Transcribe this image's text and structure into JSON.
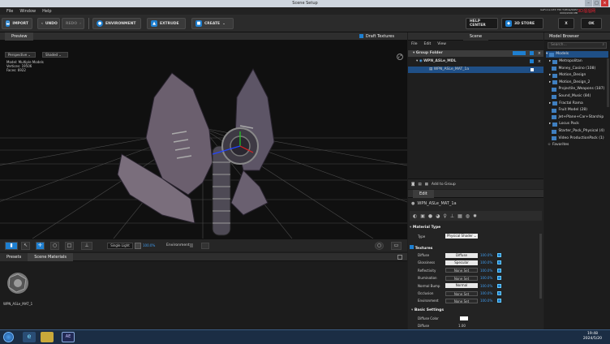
{
  "window": {
    "title": "Scene Setup",
    "controls": [
      "–",
      "□",
      "×"
    ]
  },
  "menu": [
    "File",
    "Window",
    "Help"
  ],
  "gpu_info": [
    "GeForce GTX 750 Ti/PCIe/SSE2",
    "0000/2000 MB",
    "8 / 4096"
  ],
  "watermark": "3D溜溜网",
  "toolbar": {
    "import": "IMPORT",
    "undo": "UNDO",
    "redo": "REDO",
    "environment": "ENVIRONMENT",
    "extrude": "EXTRUDE",
    "create": "CREATE",
    "help": "HELP CENTER",
    "store": "3D STORE",
    "close": "X",
    "ok": "OK"
  },
  "preview": {
    "tab": "Preview",
    "draft_label": "Draft Textures",
    "projection": "Perspective",
    "shading": "Shaded",
    "stats": [
      {
        "k": "Model:",
        "v": "Multiple Models"
      },
      {
        "k": "Vertices:",
        "v": "19506"
      },
      {
        "k": "Faces:",
        "v": "6922"
      }
    ]
  },
  "viewport_bar": {
    "light": "Single Light",
    "light_pct": "100.0%",
    "env": "Environment"
  },
  "presets": {
    "tabs": [
      "Presets",
      "Scene Materials"
    ],
    "item": "WPN_ASLe_MAT_1"
  },
  "scene": {
    "tab": "Scene",
    "menu": [
      "File",
      "Edit",
      "View"
    ],
    "group": "Group Folder",
    "model": "WPN_ASLe_MDL",
    "material": "WPN_ASLe_MAT_1a",
    "add_group": "Add to Group"
  },
  "edit": {
    "tab": "Edit",
    "material_name": "WPN_ASLe_MAT_1a",
    "mat_type_header": "Material Type",
    "type_label": "Type",
    "type_value": "Physical Shader",
    "textures_header": "Textures",
    "textures": [
      {
        "name": "Diffuse",
        "slot": "Diffuse",
        "pct": "100.0%",
        "set": true
      },
      {
        "name": "Glossiness",
        "slot": "Specular",
        "pct": "100.0%",
        "set": true
      },
      {
        "name": "Reflectivity",
        "slot": "None Set",
        "pct": "100.0%",
        "set": false
      },
      {
        "name": "Illumination",
        "slot": "None Set",
        "pct": "100.0%",
        "set": false
      },
      {
        "name": "Normal Bump",
        "slot": "Normal",
        "pct": "100.0%",
        "set": true
      },
      {
        "name": "Occlusion",
        "slot": "None Set",
        "pct": "100.0%",
        "set": false
      },
      {
        "name": "Environment",
        "slot": "None Set",
        "pct": "100.0%",
        "set": false
      }
    ],
    "basic_header": "Basic Settings",
    "basic": [
      {
        "name": "Diffuse Color"
      },
      {
        "name": "Diffuse",
        "value": "1.00"
      }
    ]
  },
  "browser": {
    "tab": "Model Browser",
    "search": "Search...",
    "root": "Models",
    "items": [
      "Metropolitan",
      "Money_Casino (108)",
      "Motion_Design",
      "Motion_Design_2",
      "Projectile_Weapons (187)",
      "Sound_Music (84)",
      "Fractal Rama",
      "Fruit Model (28)",
      "Jet+Plane+Car+Starship",
      "Locus Pack",
      "Starter_Pack_Physical (4)",
      "Video ProductionPack (1)"
    ],
    "favorites": "Favorites"
  },
  "taskbar": {
    "time": "19:48",
    "date": "2024/5/20",
    "app": "AE"
  }
}
